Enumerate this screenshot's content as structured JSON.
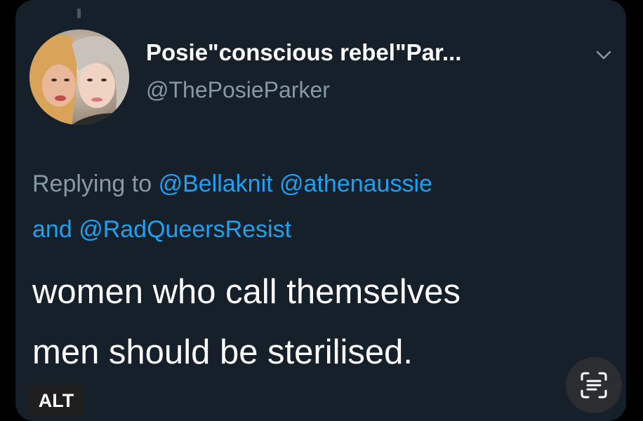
{
  "tweet": {
    "display_name": "Posie\"conscious rebel\"Par...",
    "handle": "@ThePosieParker",
    "reply_prefix": "Replying to",
    "reply_mention_1": "@Bellaknit",
    "reply_mention_2": "@athenaussie",
    "reply_and": "and",
    "reply_mention_3": "@RadQueersResist",
    "text_line_1": "women who call themselves",
    "text_line_2": "men should be sterilised."
  },
  "overlay": {
    "alt_label": "ALT"
  },
  "icons": {
    "more": "chevron-down-icon",
    "scan": "live-text-icon"
  },
  "colors": {
    "card_background": "#15202b",
    "mention": "#1da1f2",
    "secondary_text": "#8899a6",
    "primary_text": "#ffffff"
  }
}
